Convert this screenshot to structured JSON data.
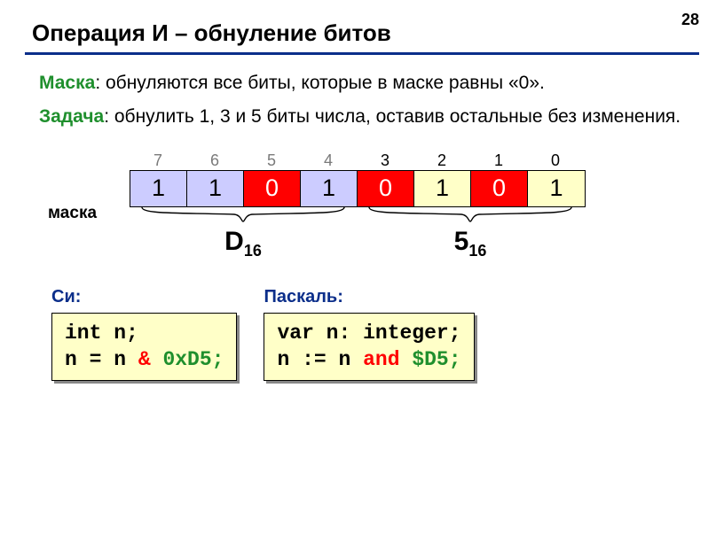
{
  "page_number": "28",
  "title": "Операция И – обнуление битов",
  "mask_kw": "Маска",
  "mask_text": ": обнуляются все биты, которые в маске равны «0».",
  "task_kw": "Задача",
  "task_text": ": обнулить 1, 3 и 5 биты числа, оставив остальные без изменения.",
  "mask_label": "маска",
  "bit_positions": [
    "7",
    "6",
    "5",
    "4",
    "3",
    "2",
    "1",
    "0"
  ],
  "bit_values": [
    "1",
    "1",
    "0",
    "1",
    "0",
    "1",
    "0",
    "1"
  ],
  "hex_high": "D",
  "hex_low": "5",
  "hex_base": "16",
  "c_label": "Си:",
  "pascal_label": "Паскаль:",
  "c_line1": "int n;",
  "c_line2a": "n = n ",
  "c_op": "&",
  "c_line2b": " 0xD5;",
  "p_line1": "var n: integer;",
  "p_line2a": "n := n ",
  "p_op": "and",
  "p_line2b": " $D5;"
}
